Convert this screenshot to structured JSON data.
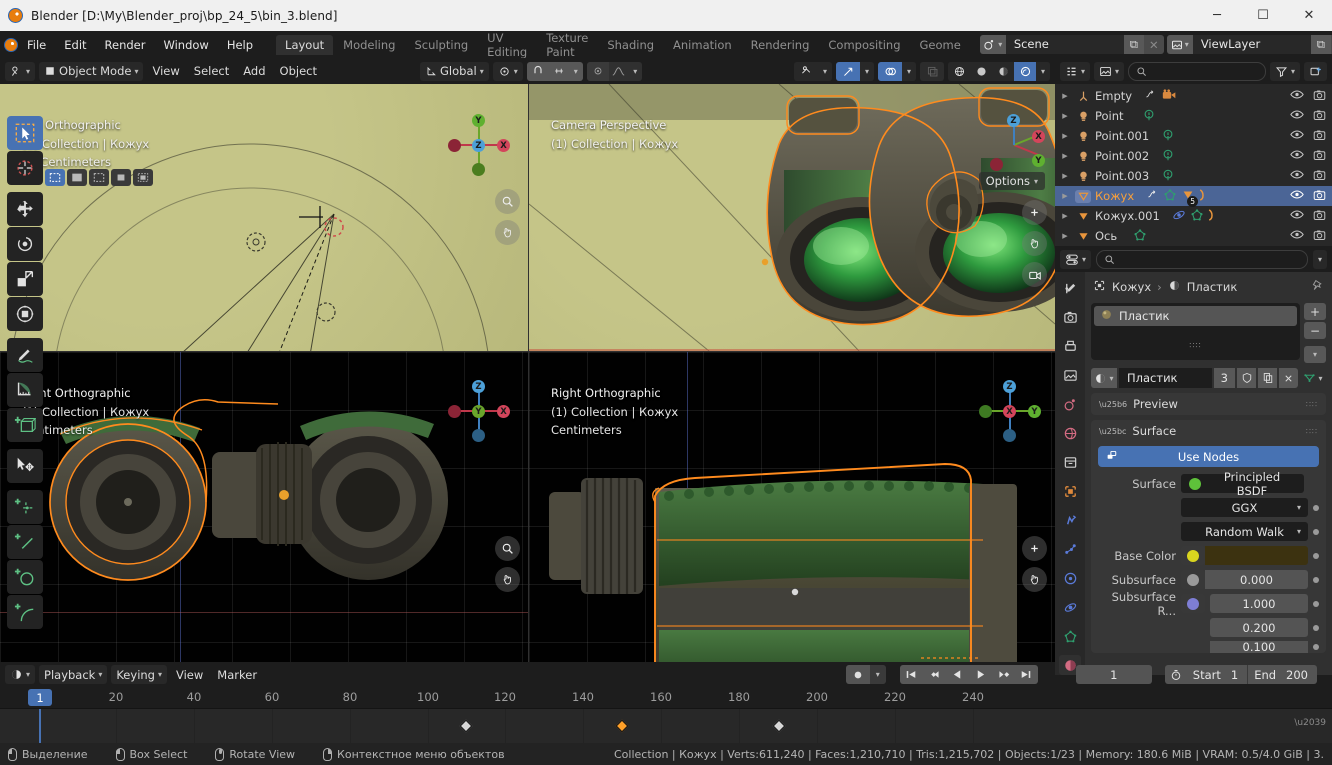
{
  "window": {
    "title": "Blender [D:\\My\\Blender_proj\\bp_24_5\\bin_3.blend]",
    "minimize": "─",
    "maximize": "☐",
    "close": "✕"
  },
  "topbar": {
    "menus": [
      "File",
      "Edit",
      "Render",
      "Window",
      "Help"
    ],
    "workspaces": [
      {
        "label": "Layout",
        "active": true
      },
      {
        "label": "Modeling",
        "active": false
      },
      {
        "label": "Sculpting",
        "active": false
      },
      {
        "label": "UV Editing",
        "active": false
      },
      {
        "label": "Texture Paint",
        "active": false
      },
      {
        "label": "Shading",
        "active": false
      },
      {
        "label": "Animation",
        "active": false
      },
      {
        "label": "Rendering",
        "active": false
      },
      {
        "label": "Compositing",
        "active": false
      },
      {
        "label": "Geome",
        "active": false
      }
    ],
    "scene_name": "Scene",
    "viewlayer_name": "ViewLayer",
    "new_scene_label": "⧉",
    "remove_scene_label": "✕",
    "new_viewlayer_label": "⧉",
    "remove_viewlayer_label": "✕"
  },
  "viewport_header": {
    "mode": "Object Mode",
    "menus": [
      "View",
      "Select",
      "Add",
      "Object"
    ],
    "transform_orientation": "Global",
    "options_label": "Options"
  },
  "toolbar": {
    "tools": [
      {
        "name": "tweak-tool",
        "active": true
      },
      {
        "name": "cursor-tool",
        "active": false
      },
      {
        "name": "move-tool",
        "active": false
      },
      {
        "name": "rotate-tool",
        "active": false
      },
      {
        "name": "scale-tool",
        "active": false
      },
      {
        "name": "transform-tool",
        "active": false
      },
      {
        "name": "annotate-tool",
        "active": false
      },
      {
        "name": "measure-tool",
        "active": false
      },
      {
        "name": "add-cube-tool",
        "active": false
      },
      {
        "name": "tweak-move-tool",
        "active": false
      },
      {
        "name": "add-point-tool",
        "active": false
      },
      {
        "name": "add-line-tool",
        "active": false
      },
      {
        "name": "add-circle-tool",
        "active": false
      },
      {
        "name": "add-arc-tool",
        "active": false
      }
    ]
  },
  "viewports": [
    {
      "id": "top",
      "view_name": "Top Orthographic",
      "collection": "(1) Collection | Кожух",
      "units": "10 Centimeters",
      "axes": [
        "Z",
        "X",
        "Y"
      ]
    },
    {
      "id": "camera",
      "view_name": "Camera Perspective",
      "collection": "(1) Collection | Кожух",
      "units": "",
      "axes": [
        "Z",
        "X",
        "Y"
      ]
    },
    {
      "id": "front",
      "view_name": "Front Orthographic",
      "collection": "(1) Collection | Кожух",
      "units": "Centimeters",
      "axes": [
        "Z",
        "X",
        "Y"
      ]
    },
    {
      "id": "right",
      "view_name": "Right Orthographic",
      "collection": "(1) Collection | Кожух",
      "units": "Centimeters",
      "axes": [
        "Z",
        "X",
        "Y"
      ]
    }
  ],
  "outliner": {
    "search_placeholder": "",
    "items": [
      {
        "name": "Empty",
        "icon": "empty-icon",
        "selected": false,
        "extras": [
          "modifier-icon",
          "camera-data-icon"
        ]
      },
      {
        "name": "Point",
        "icon": "light-icon",
        "selected": false,
        "extras": [
          "light-data-icon"
        ]
      },
      {
        "name": "Point.001",
        "icon": "light-icon",
        "selected": false,
        "extras": [
          "light-data-icon"
        ]
      },
      {
        "name": "Point.002",
        "icon": "light-icon",
        "selected": false,
        "extras": [
          "light-data-icon"
        ]
      },
      {
        "name": "Point.003",
        "icon": "light-icon",
        "selected": false,
        "extras": [
          "light-data-icon"
        ]
      },
      {
        "name": "Кожух",
        "icon": "mesh-icon",
        "selected": true,
        "extras": [
          "modifier-icon",
          "mesh-data-icon",
          "material-count-icon",
          "material-icon"
        ],
        "material_count": "5"
      },
      {
        "name": "Кожух.001",
        "icon": "mesh-icon",
        "selected": false,
        "extras": [
          "physics-icon",
          "mesh-data-icon",
          "material-icon"
        ]
      },
      {
        "name": "Ось",
        "icon": "mesh-icon",
        "selected": false,
        "extras": [
          "mesh-data-icon"
        ]
      }
    ]
  },
  "properties": {
    "search_placeholder": "",
    "breadcrumb": [
      "Кожух",
      "Пластик"
    ],
    "material_slot": "Пластик",
    "material_name": "Пластик",
    "material_users": "3",
    "add_slot_label": "+",
    "remove_slot_label": "−",
    "panels": [
      {
        "label": "Preview",
        "open": false
      },
      {
        "label": "Surface",
        "open": true
      }
    ],
    "use_nodes_label": "Use Nodes",
    "fields": [
      {
        "label": "Surface",
        "value": "Principled BSDF",
        "type": "node",
        "swatch": "#5ec13a"
      },
      {
        "label": "",
        "value": "GGX",
        "type": "dropdown"
      },
      {
        "label": "",
        "value": "Random Walk",
        "type": "dropdown"
      },
      {
        "label": "Base Color",
        "value": "",
        "type": "color",
        "swatch": "#d9d51f",
        "color": "#3c3210"
      },
      {
        "label": "Subsurface",
        "value": "0.000",
        "type": "slider",
        "swatch": "#9a9a9a"
      },
      {
        "label": "Subsurface R...",
        "value": "1.000",
        "type": "slider",
        "swatch": "#7e7ed4"
      },
      {
        "label": "",
        "value": "0.200",
        "type": "slider"
      },
      {
        "label": "",
        "value": "0.100",
        "type": "slider"
      }
    ],
    "tabs": [
      {
        "name": "tool-tab",
        "active": false
      },
      {
        "name": "render-tab",
        "active": false
      },
      {
        "name": "output-tab",
        "active": false
      },
      {
        "name": "view-layer-tab",
        "active": false
      },
      {
        "name": "scene-tab",
        "active": false
      },
      {
        "name": "world-tab",
        "active": false
      },
      {
        "name": "collection-tab",
        "active": false
      },
      {
        "name": "object-tab",
        "active": false
      },
      {
        "name": "modifier-tab",
        "active": false
      },
      {
        "name": "particles-tab",
        "active": false
      },
      {
        "name": "physics-tab",
        "active": false
      },
      {
        "name": "constraints-tab",
        "active": false
      },
      {
        "name": "data-tab",
        "active": false
      },
      {
        "name": "material-tab",
        "active": true
      }
    ]
  },
  "timeline": {
    "menus": [
      "Playback",
      "Keying",
      "View",
      "Marker"
    ],
    "current_frame": "1",
    "start_label": "Start",
    "start_value": "1",
    "end_label": "End",
    "end_value": "200",
    "ruler_ticks": [
      "20",
      "40",
      "60",
      "80",
      "100",
      "120",
      "140",
      "160",
      "180",
      "200",
      "220",
      "240"
    ],
    "keyframes": [
      {
        "frame": 105,
        "selected": false
      },
      {
        "frame": 150,
        "selected": true
      },
      {
        "frame": 190,
        "selected": false
      }
    ]
  },
  "statusbar": {
    "keymap": [
      {
        "label": "Выделение",
        "button": "left"
      },
      {
        "label": "Box Select",
        "button": "left-drag"
      },
      {
        "label": "Rotate View",
        "button": "middle"
      },
      {
        "label": "Контекстное меню объектов",
        "button": "right"
      }
    ],
    "info": "Collection | Кожух | Verts:611,240 | Faces:1,210,710 | Tris:1,215,702 | Objects:1/23 | Memory: 180.6 MiB | VRAM: 0.5/4.0 GiB | 3."
  },
  "colors": {
    "accent": "#4772b3",
    "selected_outline": "#ff8b1e",
    "background": "#303030",
    "header": "#1d1d1d",
    "viewport_khaki": "#c2c282",
    "viewport_dark": "#010101"
  }
}
